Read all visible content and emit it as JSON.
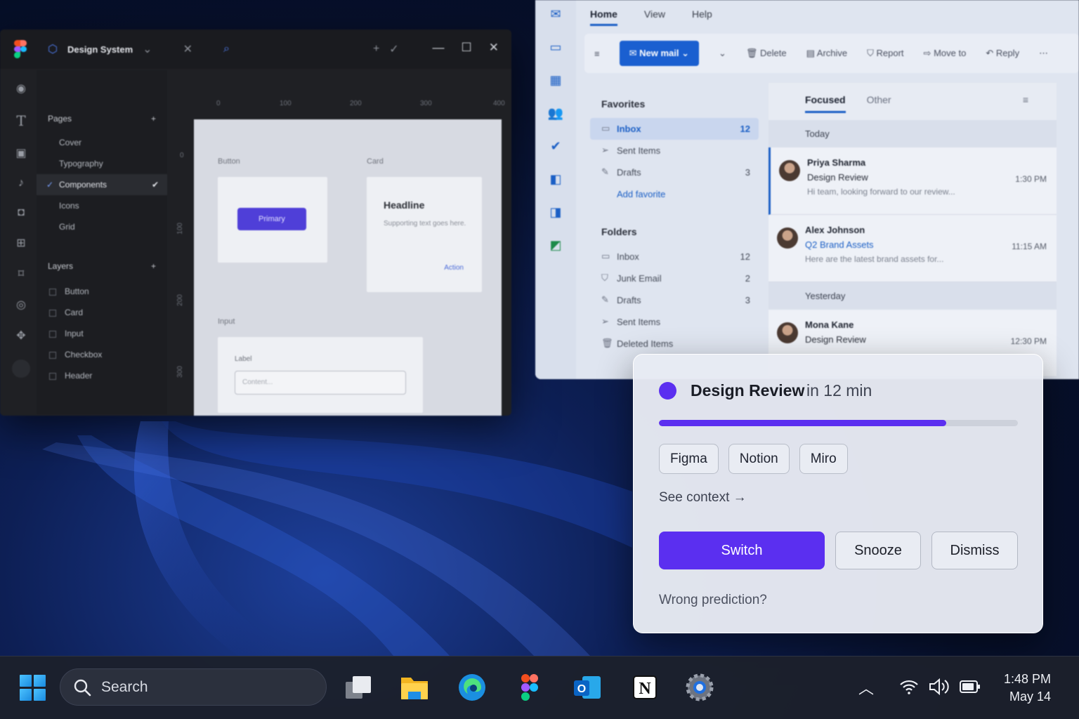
{
  "figma": {
    "file_title": "Design System",
    "pages_heading": "Pages",
    "pages": [
      "Cover",
      "Typography",
      "Components",
      "Icons",
      "Grid"
    ],
    "layers_heading": "Layers",
    "layers": [
      "Button",
      "Card",
      "Input",
      "Checkbox",
      "Header"
    ],
    "ruler_x": [
      "0",
      "100",
      "200",
      "300",
      "400"
    ],
    "ruler_y": [
      "0",
      "100",
      "200",
      "300"
    ],
    "canvas": {
      "button_label": "Button",
      "primary_button": "Primary",
      "card_label": "Card",
      "card_headline": "Headline",
      "card_support": "Supporting text goes here.",
      "card_action": "Action",
      "input_label": "Input",
      "field_label": "Label",
      "field_placeholder": "Content..."
    }
  },
  "outlook": {
    "tabs": [
      "Home",
      "View",
      "Help"
    ],
    "ribbon": {
      "new_mail": "New mail",
      "delete": "Delete",
      "archive": "Archive",
      "report": "Report",
      "move_to": "Move to",
      "reply": "Reply"
    },
    "favorites_heading": "Favorites",
    "favorites": [
      {
        "name": "Inbox",
        "count": "12"
      },
      {
        "name": "Sent Items",
        "count": ""
      },
      {
        "name": "Drafts",
        "count": "3"
      }
    ],
    "add_favorite": "Add favorite",
    "folders_heading": "Folders",
    "folders": [
      {
        "name": "Inbox",
        "count": "12"
      },
      {
        "name": "Junk Email",
        "count": "2"
      },
      {
        "name": "Drafts",
        "count": "3"
      },
      {
        "name": "Sent Items",
        "count": ""
      },
      {
        "name": "Deleted Items",
        "count": ""
      }
    ],
    "list_tabs": [
      "Focused",
      "Other"
    ],
    "group_today": "Today",
    "group_yesterday": "Yesterday",
    "messages": [
      {
        "from": "Priya Sharma",
        "subject": "Design Review",
        "preview": "Hi team, looking forward to our review...",
        "time": "1:30 PM"
      },
      {
        "from": "Alex Johnson",
        "subject": "Q2 Brand Assets",
        "preview": "Here are the latest brand assets for...",
        "time": "11:15 AM"
      },
      {
        "from": "Mona Kane",
        "subject": "Design Review",
        "preview": "",
        "time": "12:30 PM"
      }
    ]
  },
  "notification": {
    "title": "Design Review",
    "eta": "in 12 min",
    "progress_fraction": 0.8,
    "accent_color": "#5b2ff0",
    "apps": [
      "Figma",
      "Notion",
      "Miro"
    ],
    "see_context": "See context →",
    "switch": "Switch",
    "snooze": "Snooze",
    "dismiss": "Dismiss",
    "wrong_prediction": "Wrong prediction?"
  },
  "taskbar": {
    "search_placeholder": "Search",
    "apps": [
      "task-view",
      "file-explorer",
      "edge",
      "figma",
      "outlook",
      "notion",
      "settings"
    ],
    "time": "1:48 PM",
    "date": "May 14"
  }
}
